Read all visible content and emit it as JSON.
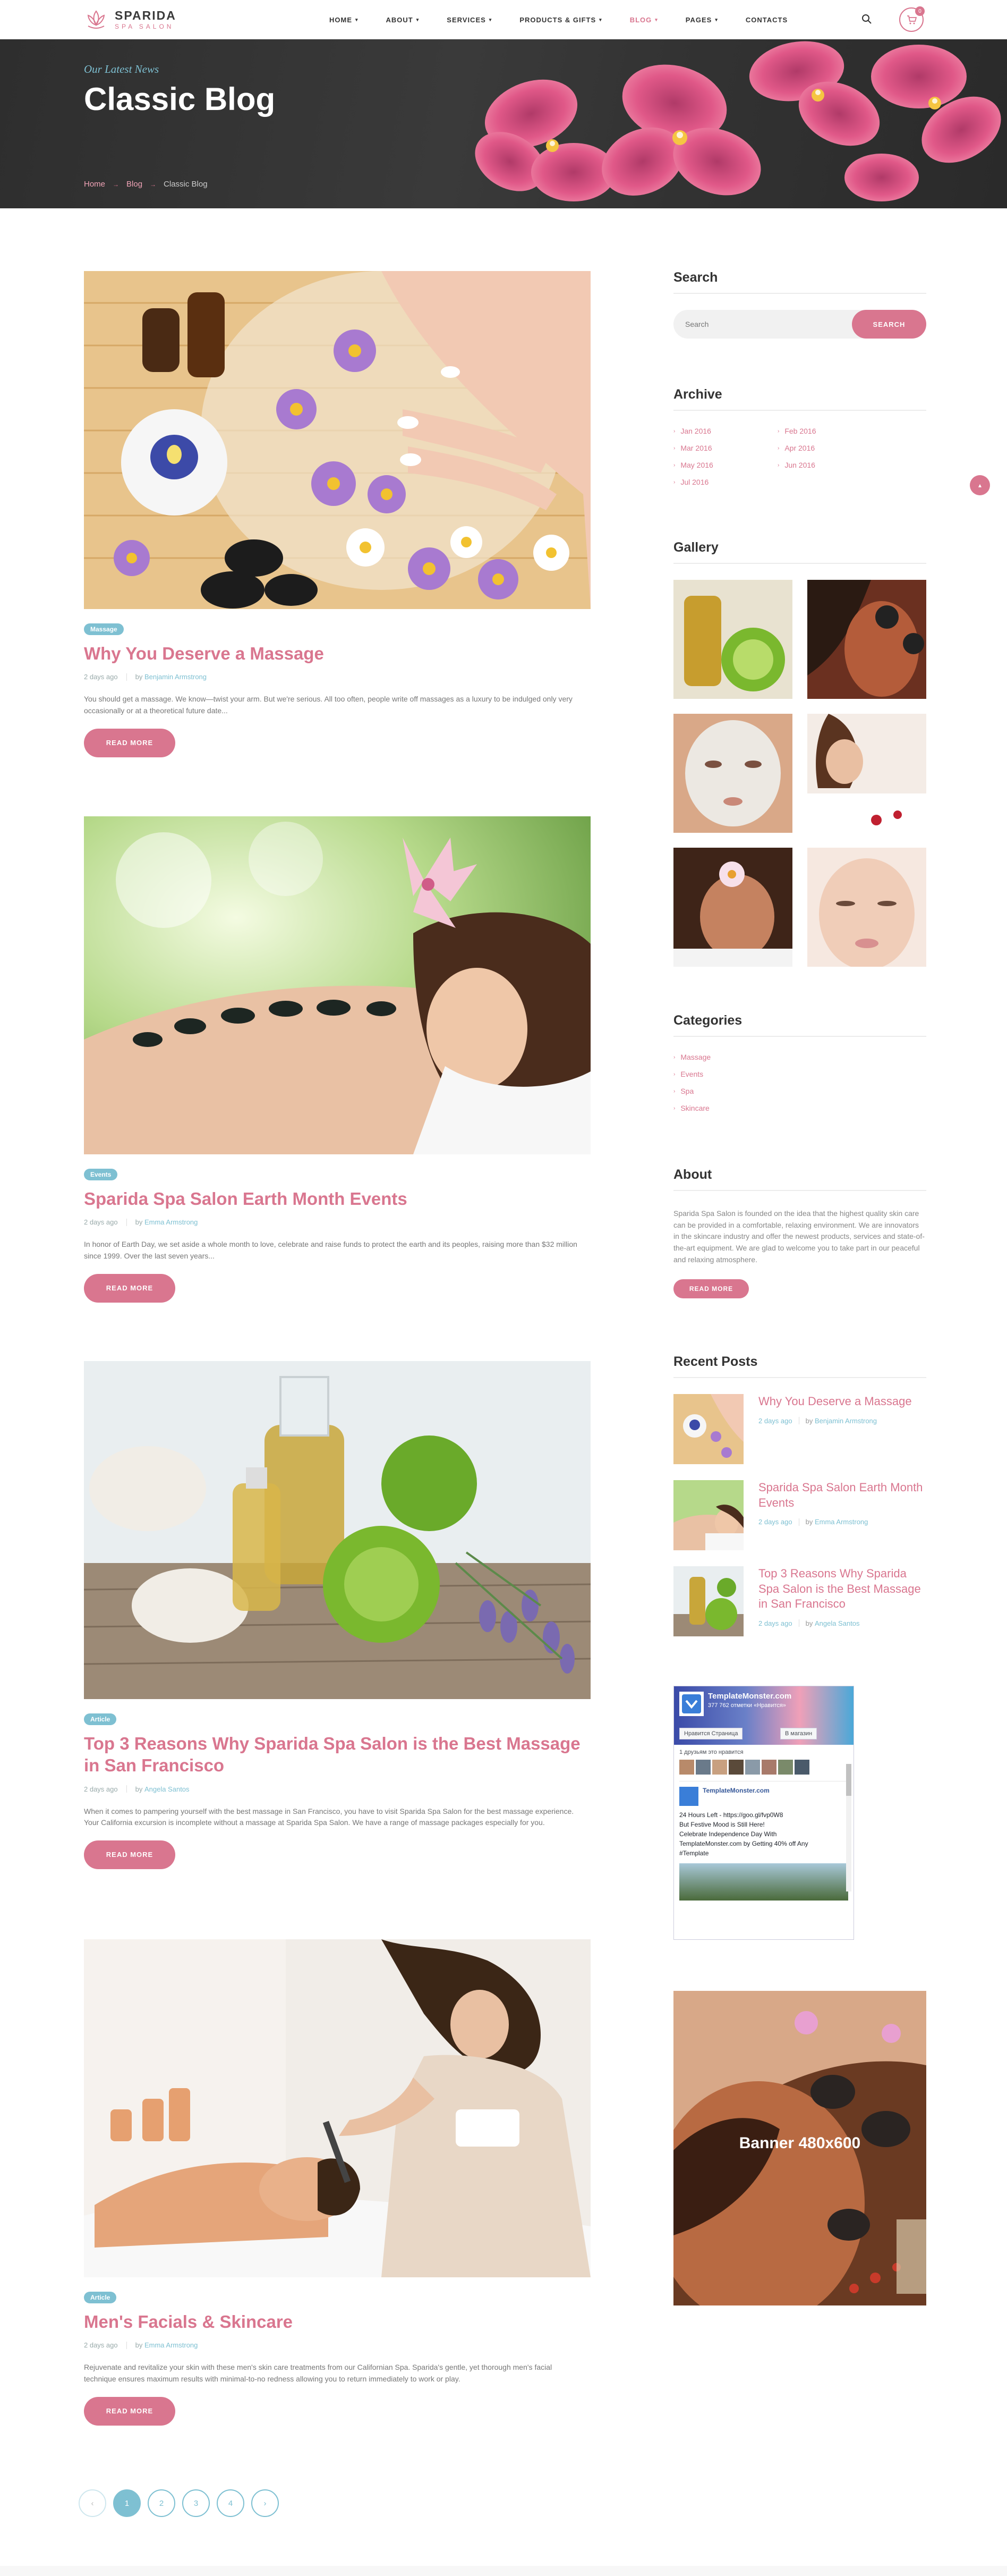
{
  "header": {
    "logo_name": "SPARIDA",
    "logo_sub": "SPA SALON",
    "nav": [
      {
        "label": "HOME",
        "caret": true
      },
      {
        "label": "ABOUT",
        "caret": true
      },
      {
        "label": "SERVICES",
        "caret": true
      },
      {
        "label": "PRODUCTS & GIFTS",
        "caret": true
      },
      {
        "label": "BLOG",
        "caret": true,
        "active": true
      },
      {
        "label": "PAGES",
        "caret": true
      },
      {
        "label": "CONTACTS",
        "caret": false
      }
    ],
    "cart_count": "0"
  },
  "hero": {
    "subtitle": "Our Latest News",
    "title": "Classic Blog",
    "breadcrumbs": [
      "Home",
      "Blog",
      "Classic Blog"
    ]
  },
  "posts": [
    {
      "tag": "Massage",
      "title": "Why You Deserve a Massage",
      "date": "2 days ago",
      "by": "by",
      "author": "Benjamin Armstrong",
      "excerpt": "You should get a massage. We know—twist your arm. But we're serious. All too often, people write off massages as a luxury to be indulged only very occasionally or at a theoretical future date...",
      "button": "READ MORE"
    },
    {
      "tag": "Events",
      "title": "Sparida Spa Salon Earth Month Events",
      "date": "2 days ago",
      "by": "by",
      "author": "Emma Armstrong",
      "excerpt": "In honor of Earth Day, we set aside a whole month to love, celebrate and raise funds to protect the earth and its peoples, raising more than $32 million since 1999. Over the last seven years...",
      "button": "READ MORE"
    },
    {
      "tag": "Article",
      "title": "Top 3 Reasons Why Sparida Spa Salon is the Best Massage in San Francisco",
      "date": "2 days ago",
      "by": "by",
      "author": "Angela Santos",
      "excerpt": "When it comes to pampering yourself with the best massage in San Francisco, you have to visit Sparida Spa Salon for the best massage experience. Your California excursion is incomplete without a massage at Sparida Spa Salon. We have a range of massage packages especially for you.",
      "button": "READ MORE"
    },
    {
      "tag": "Article",
      "title": "Men's Facials & Skincare",
      "date": "2 days ago",
      "by": "by",
      "author": "Emma Armstrong",
      "excerpt": "Rejuvenate and revitalize your skin with these men's skin care treatments from our Californian Spa. Sparida's gentle, yet thorough men's facial technique ensures maximum results with minimal-to-no redness allowing you to return immediately to work or play.",
      "button": "READ MORE"
    }
  ],
  "pagination": {
    "prev": "‹",
    "pages": [
      "1",
      "2",
      "3",
      "4"
    ],
    "next": "›",
    "current": "1"
  },
  "sidebar": {
    "search": {
      "heading": "Search",
      "placeholder": "Search",
      "button": "SEARCH"
    },
    "archive": {
      "heading": "Archive",
      "items": [
        "Jan 2016",
        "Feb 2016",
        "Mar 2016",
        "Apr 2016",
        "May 2016",
        "Jun 2016",
        "Jul 2016"
      ]
    },
    "gallery": {
      "heading": "Gallery"
    },
    "categories": {
      "heading": "Categories",
      "items": [
        "Massage",
        "Events",
        "Spa",
        "Skincare"
      ]
    },
    "about": {
      "heading": "About",
      "text": "Sparida Spa Salon is founded on the idea that the highest quality skin care can be provided in a comfortable, relaxing environment. We are innovators in the skincare industry and offer the newest products, services and state-of-the-art equipment. We are glad to welcome you to take part in our peaceful and relaxing atmosphere.",
      "button": "READ MORE"
    },
    "recent": {
      "heading": "Recent Posts",
      "items": [
        {
          "title": "Why You Deserve a Massage",
          "date": "2 days ago",
          "by": "by",
          "author": "Benjamin Armstrong"
        },
        {
          "title": "Sparida Spa Salon Earth Month Events",
          "date": "2 days ago",
          "by": "by",
          "author": "Emma Armstrong"
        },
        {
          "title": "Top 3 Reasons Why Sparida Spa Salon is the Best Massage in San Francisco",
          "date": "2 days ago",
          "by": "by",
          "author": "Angela Santos"
        }
      ]
    },
    "facebook": {
      "page_name": "TemplateMonster.com",
      "likes": "377 762 отметки «Нравится»",
      "like_btn": "Нравится Страница",
      "share_btn": "В магазин",
      "friends_text": "1 друзьям это нравится",
      "post_name": "TemplateMonster.com",
      "post_time": "24 Hours Left - https://goo.gl/fvp0W8",
      "post_line2": "But Festive Mood is Still Here!",
      "post_line3": "Celebrate Independence Day With TemplateMonster.com by Getting 40% off Any #Template"
    },
    "banner": "Banner 480x600"
  },
  "colors": {
    "accent": "#d9768f",
    "secondary": "#7ec0d2",
    "heading": "#333333"
  }
}
